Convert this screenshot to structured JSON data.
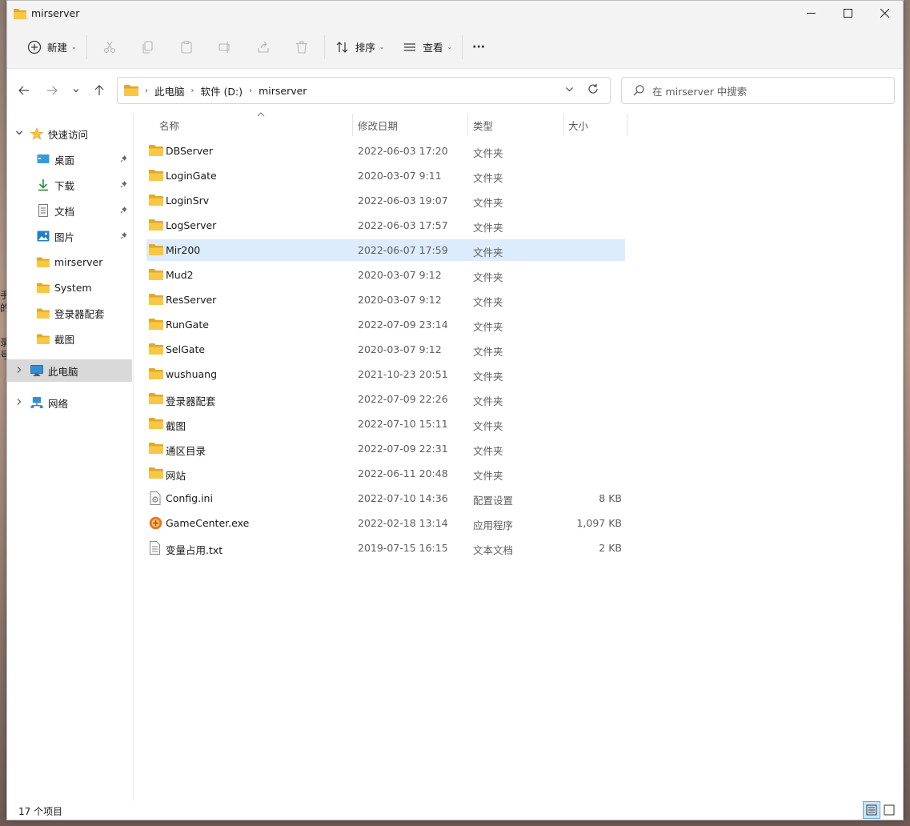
{
  "window": {
    "title": "mirserver"
  },
  "toolbar": {
    "new_label": "新建",
    "sort_label": "排序",
    "view_label": "查看",
    "more_label": "···"
  },
  "address": {
    "crumbs": [
      "此电脑",
      "软件 (D:)",
      "mirserver"
    ]
  },
  "search": {
    "placeholder": "在 mirserver 中搜索"
  },
  "sidebar": {
    "items": [
      {
        "label": "快速访问",
        "icon": "star-icon"
      },
      {
        "label": "桌面",
        "icon": "desktop-icon",
        "pinned": true
      },
      {
        "label": "下载",
        "icon": "download-icon",
        "pinned": true
      },
      {
        "label": "文档",
        "icon": "document-icon",
        "pinned": true
      },
      {
        "label": "图片",
        "icon": "picture-icon",
        "pinned": true
      },
      {
        "label": "mirserver",
        "icon": "folder-icon"
      },
      {
        "label": "System",
        "icon": "folder-icon"
      },
      {
        "label": "登录器配套",
        "icon": "folder-icon"
      },
      {
        "label": "截图",
        "icon": "folder-icon"
      },
      {
        "label": "此电脑",
        "icon": "computer-icon"
      },
      {
        "label": "网络",
        "icon": "network-icon"
      }
    ]
  },
  "columns": {
    "name": "名称",
    "date": "修改日期",
    "type": "类型",
    "size": "大小"
  },
  "files": [
    {
      "name": "DBServer",
      "date": "2022-06-03 17:20",
      "type": "文件夹",
      "size": "",
      "kind": "folder"
    },
    {
      "name": "LoginGate",
      "date": "2020-03-07 9:11",
      "type": "文件夹",
      "size": "",
      "kind": "folder"
    },
    {
      "name": "LoginSrv",
      "date": "2022-06-03 19:07",
      "type": "文件夹",
      "size": "",
      "kind": "folder"
    },
    {
      "name": "LogServer",
      "date": "2022-06-03 17:57",
      "type": "文件夹",
      "size": "",
      "kind": "folder"
    },
    {
      "name": "Mir200",
      "date": "2022-06-07 17:59",
      "type": "文件夹",
      "size": "",
      "kind": "folder",
      "selected": true
    },
    {
      "name": "Mud2",
      "date": "2020-03-07 9:12",
      "type": "文件夹",
      "size": "",
      "kind": "folder"
    },
    {
      "name": "ResServer",
      "date": "2020-03-07 9:12",
      "type": "文件夹",
      "size": "",
      "kind": "folder"
    },
    {
      "name": "RunGate",
      "date": "2022-07-09 23:14",
      "type": "文件夹",
      "size": "",
      "kind": "folder"
    },
    {
      "name": "SelGate",
      "date": "2020-03-07 9:12",
      "type": "文件夹",
      "size": "",
      "kind": "folder"
    },
    {
      "name": "wushuang",
      "date": "2021-10-23 20:51",
      "type": "文件夹",
      "size": "",
      "kind": "folder"
    },
    {
      "name": "登录器配套",
      "date": "2022-07-09 22:26",
      "type": "文件夹",
      "size": "",
      "kind": "folder"
    },
    {
      "name": "截图",
      "date": "2022-07-10 15:11",
      "type": "文件夹",
      "size": "",
      "kind": "folder"
    },
    {
      "name": "通区目录",
      "date": "2022-07-09 22:31",
      "type": "文件夹",
      "size": "",
      "kind": "folder"
    },
    {
      "name": "网站",
      "date": "2022-06-11 20:48",
      "type": "文件夹",
      "size": "",
      "kind": "folder"
    },
    {
      "name": "Config.ini",
      "date": "2022-07-10 14:36",
      "type": "配置设置",
      "size": "8 KB",
      "kind": "ini"
    },
    {
      "name": "GameCenter.exe",
      "date": "2022-02-18 13:14",
      "type": "应用程序",
      "size": "1,097 KB",
      "kind": "exe"
    },
    {
      "name": "变量占用.txt",
      "date": "2019-07-15 16:15",
      "type": "文本文档",
      "size": "2 KB",
      "kind": "txt"
    }
  ],
  "status": {
    "item_count": "17 个项目"
  },
  "colors": {
    "folder": "#f8c746",
    "folder_dark": "#e5a823",
    "selected_row": "#dcecfc",
    "accent": "#0067c0"
  }
}
